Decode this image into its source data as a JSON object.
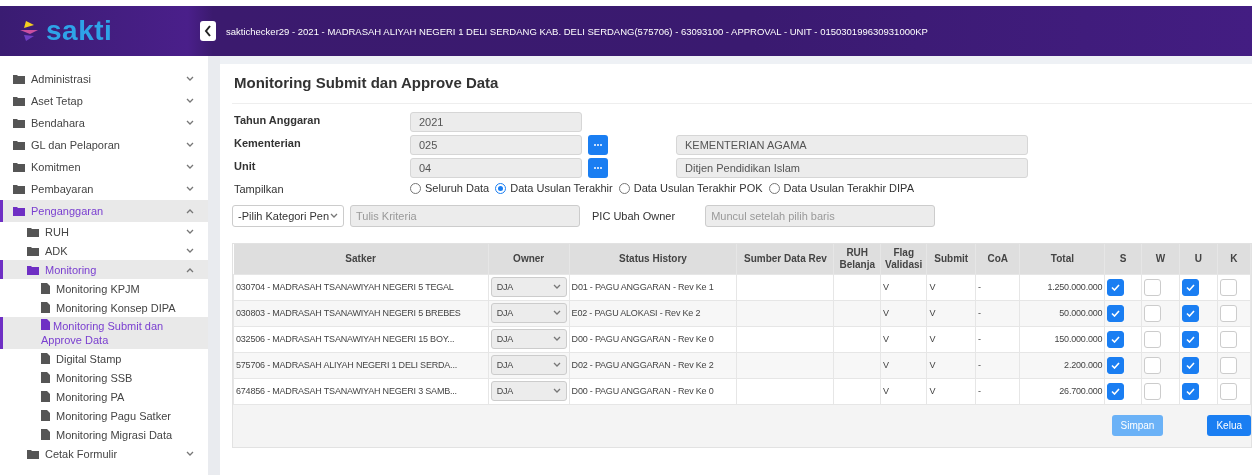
{
  "header": {
    "logo_text": "sakti",
    "info": "saktichecker29 - 2021 - MADRASAH ALIYAH NEGERI 1 DELI SERDANG KAB. DELI SERDANG(575706) - 63093100 - APPROVAL - UNIT - 015030199630931000KP"
  },
  "sidebar": {
    "items": [
      {
        "label": "Administrasi",
        "expanded": false,
        "selected": false
      },
      {
        "label": "Aset Tetap",
        "expanded": false,
        "selected": false
      },
      {
        "label": "Bendahara",
        "expanded": false,
        "selected": false
      },
      {
        "label": "GL dan Pelaporan",
        "expanded": false,
        "selected": false
      },
      {
        "label": "Komitmen",
        "expanded": false,
        "selected": false
      },
      {
        "label": "Pembayaran",
        "expanded": false,
        "selected": false
      },
      {
        "label": "Penganggaran",
        "expanded": true,
        "selected": true,
        "children": [
          {
            "label": "RUH",
            "expanded": false,
            "selected": false
          },
          {
            "label": "ADK",
            "expanded": false,
            "selected": false
          },
          {
            "label": "Monitoring",
            "expanded": true,
            "selected": true,
            "children": [
              {
                "label": "Monitoring KPJM",
                "selected": false
              },
              {
                "label": "Monitoring Konsep DIPA",
                "selected": false
              },
              {
                "label": "Monitoring Submit dan Approve Data",
                "selected": true
              },
              {
                "label": "Digital Stamp",
                "selected": false
              },
              {
                "label": "Monitoring SSB",
                "selected": false
              },
              {
                "label": "Monitoring PA",
                "selected": false
              },
              {
                "label": "Monitoring Pagu Satker",
                "selected": false
              },
              {
                "label": "Monitoring Migrasi Data",
                "selected": false
              }
            ]
          },
          {
            "label": "Cetak Formulir",
            "expanded": false,
            "selected": false
          }
        ]
      }
    ]
  },
  "page": {
    "title": "Monitoring Submit dan Approve Data",
    "fields": [
      {
        "label": "Tahun Anggaran",
        "value": "2021"
      },
      {
        "label": "Kementerian",
        "value": "025",
        "name": "KEMENTERIAN AGAMA"
      },
      {
        "label": "Unit",
        "value": "04",
        "name": "Ditjen Pendidikan Islam"
      }
    ],
    "tampilkan": {
      "label": "Tampilkan",
      "options": [
        {
          "label": "Seluruh Data",
          "selected": false
        },
        {
          "label": "Data Usulan Terakhir",
          "selected": true
        },
        {
          "label": "Data Usulan Terakhir POK",
          "selected": false
        },
        {
          "label": "Data Usulan Terakhir DIPA",
          "selected": false
        }
      ]
    },
    "filter": {
      "category": "-Pilih Kategori Pen",
      "criteria_placeholder": "Tulis Kriteria",
      "pic_label": "PIC Ubah Owner",
      "pic_placeholder": "Muncul setelah pilih baris"
    },
    "table": {
      "columns": [
        "Satker",
        "Owner",
        "Status History",
        "Sumber Data Rev",
        "RUH Belanja",
        "Flag Validasi",
        "Submit",
        "CoA",
        "Total",
        "S",
        "W",
        "U",
        "K"
      ],
      "rows": [
        {
          "satker": "030704 - MADRASAH TSANAWIYAH NEGERI 5 TEGAL",
          "owner": "DJA",
          "status": "D01 - PAGU ANGGARAN - Rev Ke 1",
          "flag": "V",
          "submit": "V",
          "coa": "-",
          "total": "1.250.000.000",
          "s": true,
          "w": false,
          "u": true,
          "k": false
        },
        {
          "satker": "030803 - MADRASAH TSANAWIYAH NEGERI 5 BREBES",
          "owner": "DJA",
          "status": "E02 - PAGU ALOKASI - Rev Ke 2",
          "flag": "V",
          "submit": "V",
          "coa": "-",
          "total": "50.000.000",
          "s": true,
          "w": false,
          "u": true,
          "k": false
        },
        {
          "satker": "032506 - MADRASAH TSANAWIYAH NEGERI 15 BOY...",
          "owner": "DJA",
          "status": "D00 - PAGU ANGGARAN - Rev Ke 0",
          "flag": "V",
          "submit": "V",
          "coa": "-",
          "total": "150.000.000",
          "s": true,
          "w": false,
          "u": true,
          "k": false
        },
        {
          "satker": "575706 - MADRASAH ALIYAH NEGERI 1 DELI SERDA...",
          "owner": "DJA",
          "status": "D02 - PAGU ANGGARAN - Rev Ke 2",
          "flag": "V",
          "submit": "V",
          "coa": "-",
          "total": "2.200.000",
          "s": true,
          "w": false,
          "u": true,
          "k": false
        },
        {
          "satker": "674856 - MADRASAH TSANAWIYAH NEGERI 3 SAMB...",
          "owner": "DJA",
          "status": "D00 - PAGU ANGGARAN - Rev Ke 0",
          "flag": "V",
          "submit": "V",
          "coa": "-",
          "total": "26.700.000",
          "s": true,
          "w": false,
          "u": true,
          "k": false
        }
      ]
    },
    "buttons": [
      {
        "label": "Simpan",
        "disabled": true
      },
      {
        "label": "Kelua",
        "disabled": false
      }
    ]
  }
}
